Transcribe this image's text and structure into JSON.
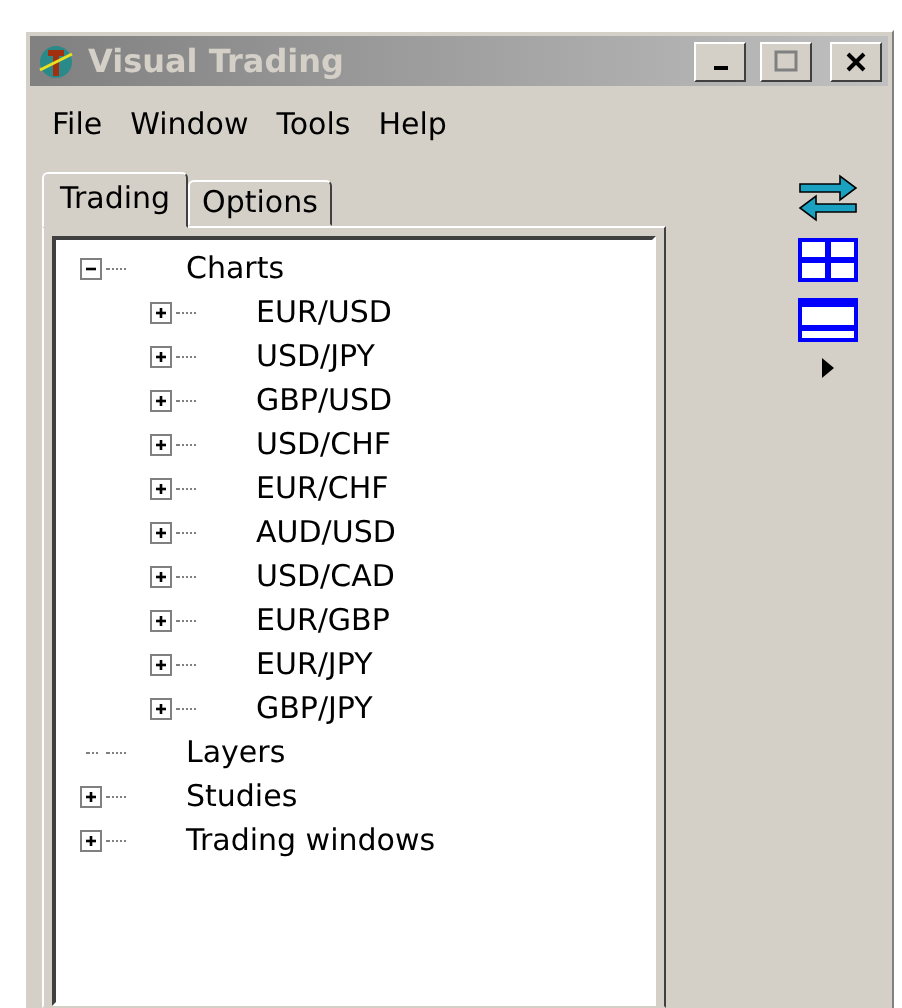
{
  "window": {
    "title": "Visual Trading",
    "active": false
  },
  "menu": [
    "File",
    "Window",
    "Tools",
    "Help"
  ],
  "tabs": [
    {
      "label": "Trading",
      "selected": true
    },
    {
      "label": "Options",
      "selected": false
    }
  ],
  "tree": [
    {
      "label": "Charts",
      "kind": "node",
      "expanded": true,
      "children": [
        {
          "label": "EUR/USD",
          "kind": "node",
          "expanded": false
        },
        {
          "label": "USD/JPY",
          "kind": "node",
          "expanded": false
        },
        {
          "label": "GBP/USD",
          "kind": "node",
          "expanded": false
        },
        {
          "label": "USD/CHF",
          "kind": "node",
          "expanded": false
        },
        {
          "label": "EUR/CHF",
          "kind": "node",
          "expanded": false
        },
        {
          "label": "AUD/USD",
          "kind": "node",
          "expanded": false
        },
        {
          "label": "USD/CAD",
          "kind": "node",
          "expanded": false
        },
        {
          "label": "EUR/GBP",
          "kind": "node",
          "expanded": false
        },
        {
          "label": "EUR/JPY",
          "kind": "node",
          "expanded": false
        },
        {
          "label": "GBP/JPY",
          "kind": "node",
          "expanded": false
        }
      ]
    },
    {
      "label": "Layers",
      "kind": "leaf"
    },
    {
      "label": "Studies",
      "kind": "node",
      "expanded": false
    },
    {
      "label": "Trading windows",
      "kind": "node",
      "expanded": false
    }
  ],
  "toolbar": [
    {
      "kind": "swap"
    },
    {
      "kind": "grid"
    },
    {
      "kind": "split"
    },
    {
      "kind": "more"
    }
  ]
}
